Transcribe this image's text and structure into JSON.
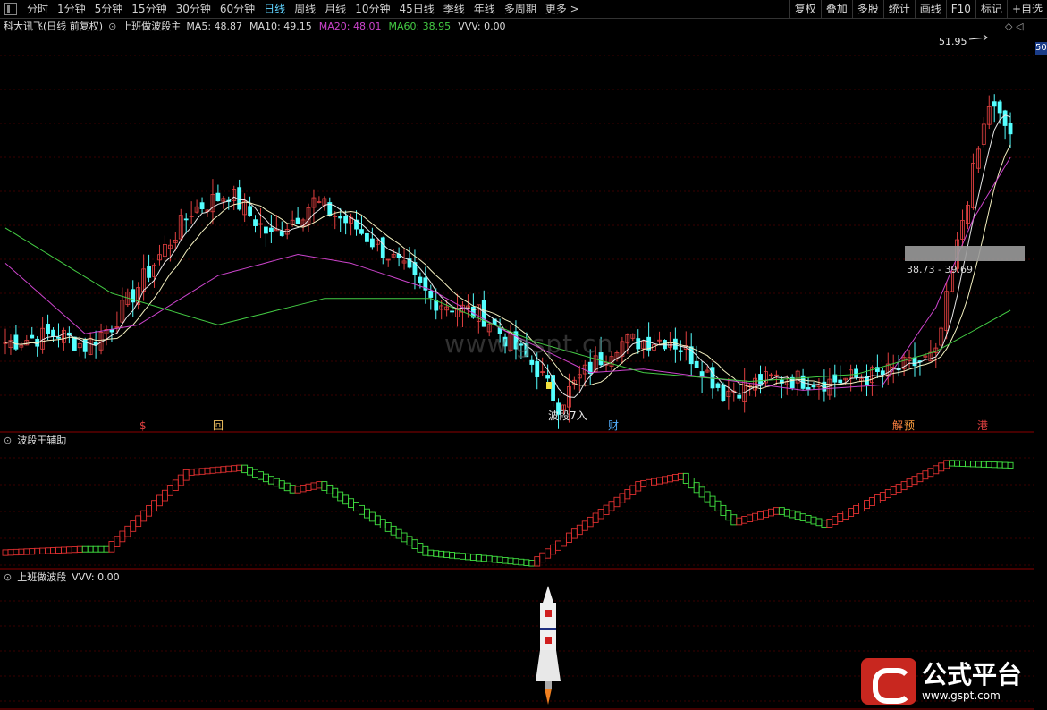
{
  "toolbar": {
    "periods": [
      "分时",
      "1分钟",
      "5分钟",
      "15分钟",
      "30分钟",
      "60分钟",
      "日线",
      "周线",
      "月线",
      "10分钟",
      "45日线",
      "季线",
      "年线",
      "多周期",
      "更多 >"
    ],
    "active_index": 6,
    "right_buttons": [
      "复权",
      "叠加",
      "多股",
      "统计",
      "画线",
      "F10",
      "标记",
      "+自选"
    ]
  },
  "main_panel": {
    "stock_title": "科大讯飞(日线 前复权)",
    "indicator_name": "上班做波段主",
    "ma_items": [
      {
        "label": "MA5: 48.87",
        "color": "#d8d8d8"
      },
      {
        "label": "MA10: 49.15",
        "color": "#d8d8d8"
      },
      {
        "label": "MA20: 48.01",
        "color": "#cc44cc"
      },
      {
        "label": "MA60: 38.95",
        "color": "#44cc44"
      },
      {
        "label": "VVV: 0.00",
        "color": "#d8d8d8"
      }
    ],
    "high_label": "51.95",
    "low_label": "波段7入",
    "range_label": "38.73 - 39.69",
    "price_tag": "50",
    "event_markers": [
      "$",
      "回",
      "财",
      "解",
      "预",
      "港"
    ],
    "watermark": "www.gspt.cn",
    "corner_icons": "◇ ◁"
  },
  "aux_panel": {
    "name": "波段王辅助"
  },
  "bottom_panel": {
    "name": "上班做波段",
    "value_label": "VVV: 0.00"
  },
  "logo": {
    "name": "公式平台",
    "url": "www.gspt.com"
  },
  "colors": {
    "up": "#e04040",
    "down": "#54ffff",
    "ma20": "#cc44cc",
    "ma60": "#44cc44",
    "ma_white": "#e8e8e8",
    "grid": "#3a0000",
    "panel_border": "#8b0000"
  },
  "chart_data": {
    "type": "candlestick",
    "price_ylim": [
      33.0,
      54.5
    ],
    "ma60_anchors": [
      [
        0,
        43.5
      ],
      [
        20,
        39.8
      ],
      [
        40,
        38.0
      ],
      [
        60,
        39.5
      ],
      [
        80,
        39.5
      ],
      [
        100,
        37.0
      ],
      [
        120,
        35.3
      ],
      [
        140,
        34.8
      ],
      [
        160,
        35.2
      ],
      [
        175,
        36.5
      ],
      [
        190,
        39.0
      ]
    ],
    "ma20_anchors": [
      [
        0,
        41.5
      ],
      [
        15,
        37.5
      ],
      [
        25,
        38.0
      ],
      [
        40,
        40.8
      ],
      [
        55,
        42.0
      ],
      [
        65,
        41.5
      ],
      [
        80,
        40.0
      ],
      [
        95,
        37.5
      ],
      [
        110,
        35.3
      ],
      [
        120,
        35.5
      ],
      [
        135,
        34.9
      ],
      [
        150,
        34.3
      ],
      [
        165,
        34.6
      ],
      [
        175,
        39.0
      ],
      [
        182,
        44.0
      ],
      [
        190,
        48.0
      ]
    ],
    "aux_ylim": [
      0,
      100
    ],
    "aux_segments": [
      {
        "start": 0,
        "end": 15,
        "from": 12,
        "to": 15,
        "color": "red"
      },
      {
        "start": 15,
        "end": 20,
        "from": 15,
        "to": 15,
        "color": "green"
      },
      {
        "start": 20,
        "end": 35,
        "from": 15,
        "to": 80,
        "color": "red"
      },
      {
        "start": 35,
        "end": 45,
        "from": 80,
        "to": 84,
        "color": "red"
      },
      {
        "start": 45,
        "end": 55,
        "from": 84,
        "to": 65,
        "color": "green"
      },
      {
        "start": 55,
        "end": 60,
        "from": 65,
        "to": 70,
        "color": "red"
      },
      {
        "start": 60,
        "end": 80,
        "from": 70,
        "to": 12,
        "color": "green"
      },
      {
        "start": 80,
        "end": 100,
        "from": 12,
        "to": 3,
        "color": "green"
      },
      {
        "start": 100,
        "end": 120,
        "from": 3,
        "to": 70,
        "color": "red"
      },
      {
        "start": 120,
        "end": 128,
        "from": 70,
        "to": 77,
        "color": "red"
      },
      {
        "start": 128,
        "end": 138,
        "from": 77,
        "to": 38,
        "color": "green"
      },
      {
        "start": 138,
        "end": 146,
        "from": 38,
        "to": 48,
        "color": "red"
      },
      {
        "start": 146,
        "end": 155,
        "from": 48,
        "to": 36,
        "color": "green"
      },
      {
        "start": 155,
        "end": 170,
        "from": 36,
        "to": 70,
        "color": "red"
      },
      {
        "start": 170,
        "end": 178,
        "from": 70,
        "to": 88,
        "color": "red"
      },
      {
        "start": 178,
        "end": 190,
        "from": 88,
        "to": 86,
        "color": "green"
      }
    ]
  }
}
